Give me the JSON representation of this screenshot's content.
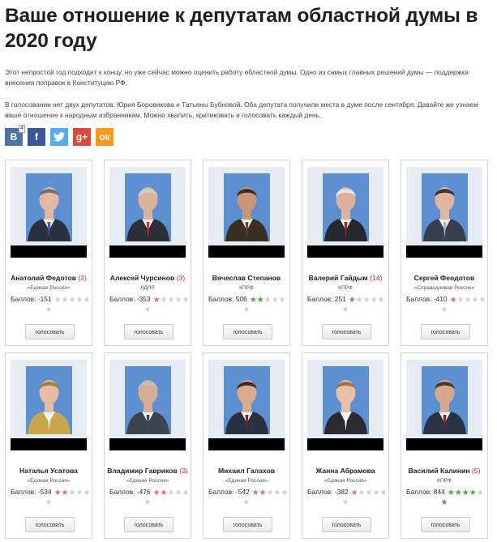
{
  "title": "Ваше отношение к депутатам областной думы в 2020 году",
  "intro": {
    "p1": "Этот непростой год подходит к концу, но уже сейчас можно оценить работу областной думы. Одно из самых главных решений думы — поддержка внесения поправок в Конституцию РФ.",
    "p2": "В голосовании нет двух депутатов: Юрия Боровикова и Татьяны Бубновой. Оба депутата получили места в думе после сентября. Давайте же узнаем ваше отношение к народным избранникам. Можно хвалить, критиковать и голосовать каждый день."
  },
  "social": [
    {
      "icon": "vk-icon",
      "label": "В",
      "color": "#4c75a3",
      "count": "4"
    },
    {
      "icon": "facebook-icon",
      "label": "f",
      "color": "#3b5998",
      "count": ""
    },
    {
      "icon": "twitter-icon",
      "label": "",
      "color": "#55acee",
      "count": ""
    },
    {
      "icon": "google-plus-icon",
      "label": "g+",
      "color": "#dc4a38",
      "count": ""
    },
    {
      "icon": "odnoklassniki-icon",
      "label": "ок",
      "color": "#f59a1b",
      "count": ""
    }
  ],
  "score_label": "Баллов:",
  "vote_label": "голосовать",
  "deputies": [
    {
      "name": "Анатолий Федотов",
      "count": "(2)",
      "party": "«Единая Россия»",
      "score": "-151",
      "stars_filled": 0,
      "stars_color": "red",
      "extra_star": "empty",
      "tie": "#3d5fb0",
      "suit": "#2a3140",
      "hair": "#6b6f76",
      "skin": "#e2b8a0"
    },
    {
      "name": "Алексей Чурсинов",
      "count": "(3)",
      "party": "ЛДПР",
      "score": "-353",
      "stars_filled": 1,
      "stars_color": "red",
      "extra_star": "empty",
      "tie": "#c53434",
      "suit": "#2b2f38",
      "hair": "#ccc",
      "skin": "#dcb39a"
    },
    {
      "name": "Вячеслав Степанов",
      "count": "",
      "party": "КПРФ",
      "score": "506",
      "stars_filled": 2,
      "stars_color": "green",
      "extra_star": "empty",
      "tie": "#6d4030",
      "suit": "#3a3022",
      "hair": "#3b2a22",
      "skin": "#c9957a"
    },
    {
      "name": "Валерий Гайдым",
      "count": "(14)",
      "party": "КПРФ",
      "score": "251",
      "stars_filled": 1,
      "stars_color": "green",
      "extra_star": "empty",
      "tie": "#8a2a2a",
      "suit": "#262a30",
      "hair": "#e6e6e6",
      "skin": "#dcb29c"
    },
    {
      "name": "Сергей Феодотов",
      "count": "",
      "party": "«Справедливая Россия»",
      "score": "-410",
      "stars_filled": 1,
      "stars_color": "red",
      "extra_star": "empty",
      "tie": "#a8b3c0",
      "suit": "#384050",
      "hair": "#3a3531",
      "skin": "#e0b59e"
    },
    {
      "name": "Наталья Усатова",
      "count": "",
      "party": "«Единая Россия»",
      "score": "-534",
      "stars_filled": 2,
      "stars_color": "red",
      "extra_star": "empty",
      "tie": "#f2f2f2",
      "suit": "#c9a64a",
      "hair": "#a87a3d",
      "skin": "#e6bca4"
    },
    {
      "name": "Владимир Гавриков",
      "count": "(3)",
      "party": "«Единая Россия»",
      "score": "-476",
      "stars_filled": 2,
      "stars_color": "red",
      "extra_star": "empty",
      "tie": "#3a4a70",
      "suit": "#3e444e",
      "hair": "#bdbdbd",
      "skin": "#d7ab95"
    },
    {
      "name": "Михаил Галахов",
      "count": "",
      "party": "«Единая Россия»",
      "score": "-542",
      "stars_filled": 2,
      "stars_color": "red",
      "extra_star": "empty",
      "tie": "#7a2a2e",
      "suit": "#2a3140",
      "hair": "#3a2a22",
      "skin": "#d9ab90"
    },
    {
      "name": "Жанна Абрамова",
      "count": "",
      "party": "«Единая Россия»",
      "score": "-382",
      "stars_filled": 1,
      "stars_color": "red",
      "extra_star": "empty",
      "tie": "#ffffff",
      "suit": "#2b2a30",
      "hair": "#a07048",
      "skin": "#e7c0a8"
    },
    {
      "name": "Василий Калинин",
      "count": "(5)",
      "party": "КПРФ",
      "score": "844",
      "stars_filled": 4,
      "stars_color": "green",
      "extra_star": "green",
      "tie": "#8a2020",
      "suit": "#2a3346",
      "hair": "#4b3a2e",
      "skin": "#d6a88c"
    }
  ]
}
